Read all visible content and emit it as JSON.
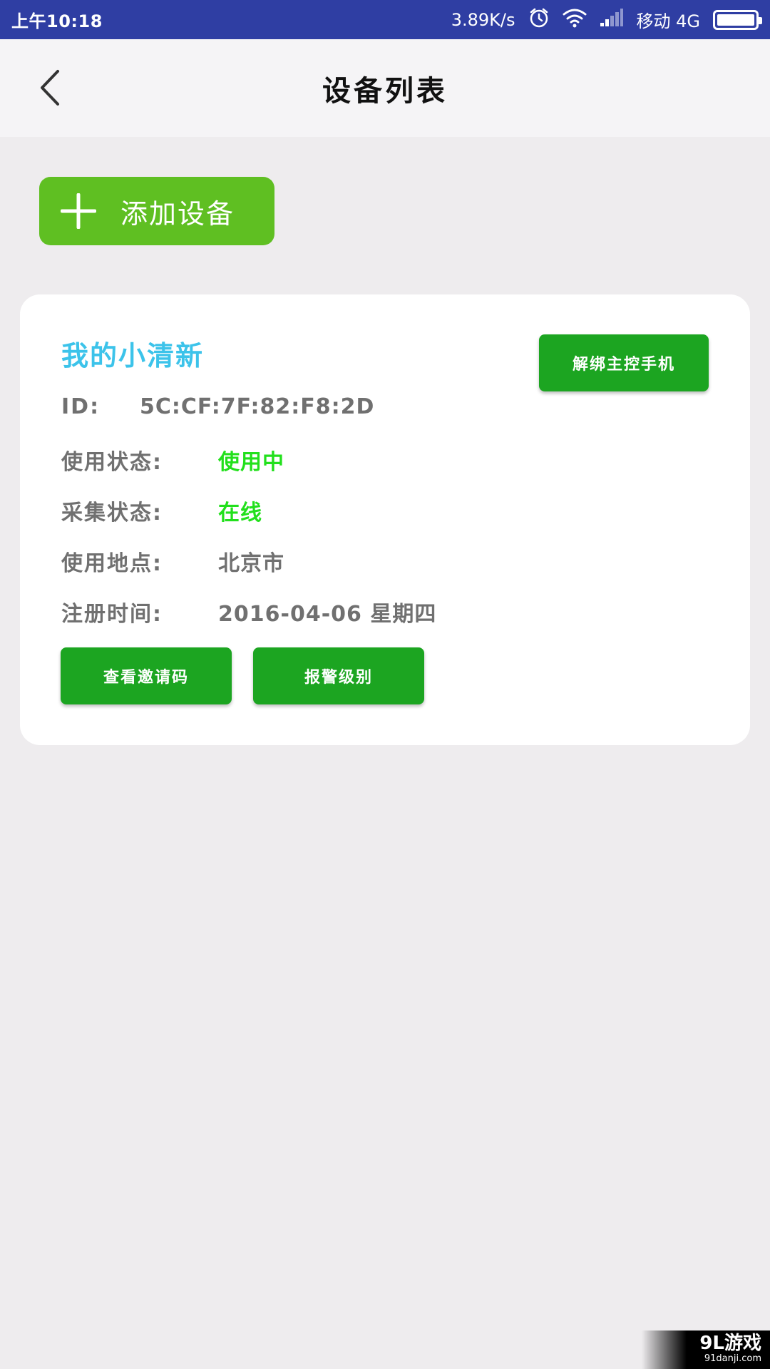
{
  "status_bar": {
    "time": "上午10:18",
    "speed": "3.89K/s",
    "carrier": "移动 4G",
    "icons": [
      "alarm-icon",
      "wifi-icon",
      "signal-icon",
      "battery-icon"
    ]
  },
  "header": {
    "title": "设备列表",
    "back_icon": "chevron-left-icon"
  },
  "add_device": {
    "label": "添加设备",
    "icon": "plus-icon"
  },
  "device": {
    "name": "我的小清新",
    "unbind_label": "解绑主控手机",
    "id_label": "ID:",
    "id_value": "5C:CF:7F:82:F8:2D",
    "usage_status_label": "使用状态:",
    "usage_status_value": "使用中",
    "collect_status_label": "采集状态:",
    "collect_status_value": "在线",
    "location_label": "使用地点:",
    "location_value": "北京市",
    "register_time_label": "注册时间:",
    "register_time_value": "2016-04-06 星期四",
    "invite_code_label": "查看邀请码",
    "alarm_level_label": "报警级别"
  },
  "watermark": {
    "main": "9L游戏",
    "sub": "91danji.com"
  },
  "colors": {
    "status_bar": "#2f3ea3",
    "add_button": "#5fbf22",
    "action_button": "#1ca521",
    "device_name": "#3cc3ea",
    "status_green": "#22e01c",
    "text_gray": "#707070"
  }
}
